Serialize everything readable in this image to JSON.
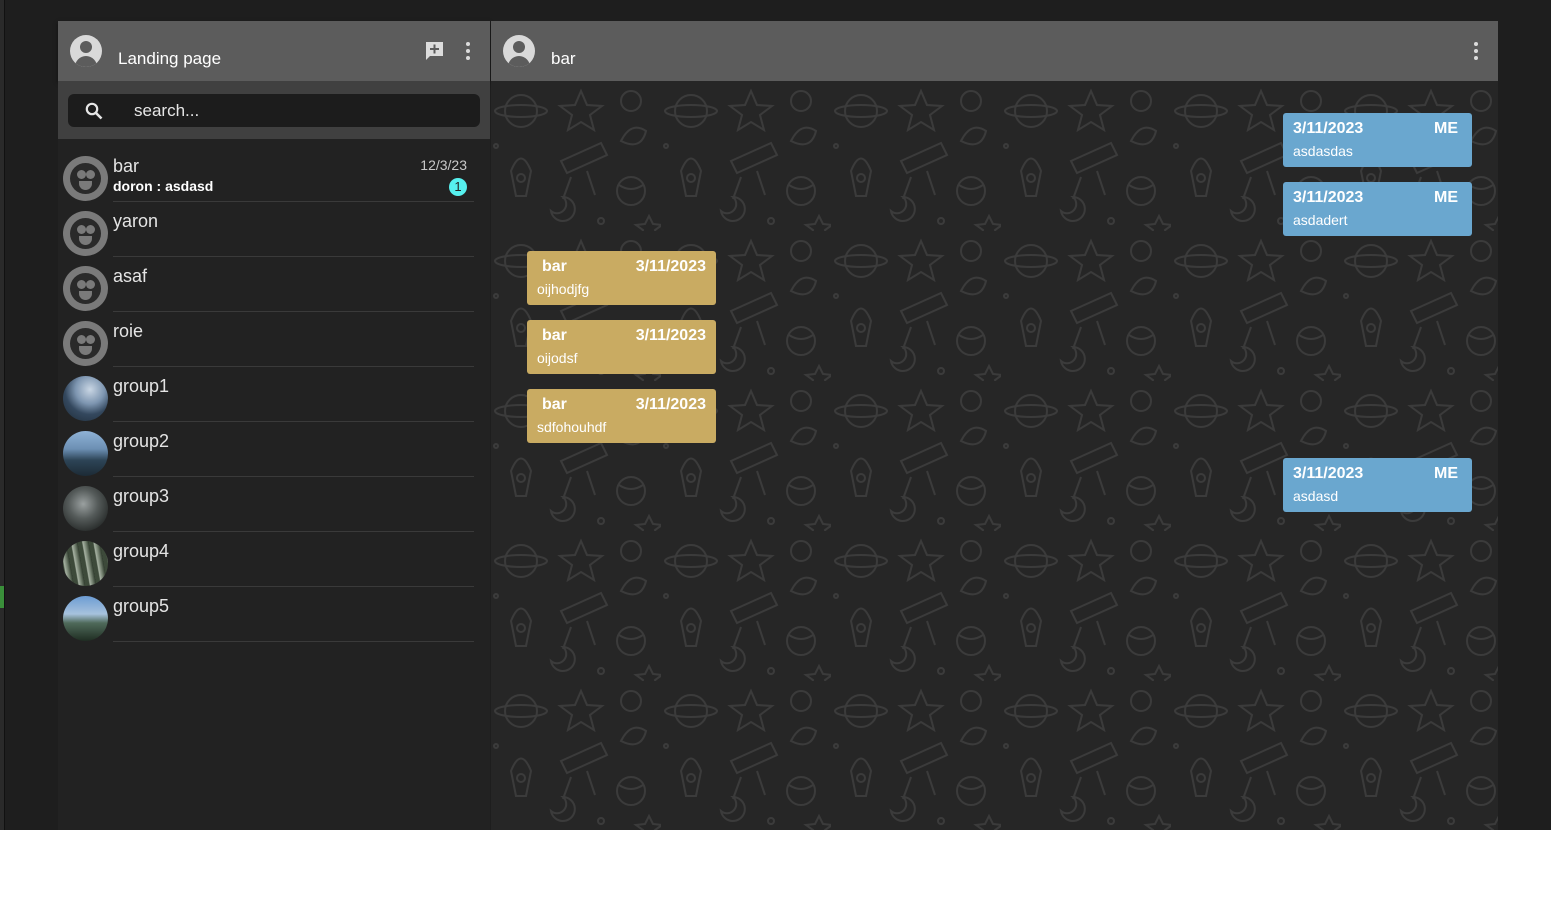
{
  "sidebar": {
    "title": "Landing page",
    "search_placeholder": "search...",
    "chats": [
      {
        "name": "bar",
        "preview": "doron : asdasd",
        "time": "12/3/23",
        "unread": "1",
        "avatar": "default"
      },
      {
        "name": "yaron",
        "avatar": "default"
      },
      {
        "name": "asaf",
        "avatar": "default"
      },
      {
        "name": "roie",
        "avatar": "default"
      },
      {
        "name": "group1",
        "avatar": "photo-mountain-lake"
      },
      {
        "name": "group2",
        "avatar": "photo-trees-sky"
      },
      {
        "name": "group3",
        "avatar": "photo-dark-interior"
      },
      {
        "name": "group4",
        "avatar": "photo-forest"
      },
      {
        "name": "group5",
        "avatar": "photo-valley-sky"
      }
    ]
  },
  "conversation": {
    "title": "bar",
    "messages": [
      {
        "from_me": true,
        "date": "3/11/2023",
        "sender": "ME",
        "text": "asdasdas"
      },
      {
        "from_me": true,
        "date": "3/11/2023",
        "sender": "ME",
        "text": "asdadert"
      },
      {
        "from_me": false,
        "date": "3/11/2023",
        "sender": "bar",
        "text": "oijhodjfg"
      },
      {
        "from_me": false,
        "date": "3/11/2023",
        "sender": "bar",
        "text": "oijodsf"
      },
      {
        "from_me": false,
        "date": "3/11/2023",
        "sender": "bar",
        "text": "sdfohouhdf"
      },
      {
        "from_me": true,
        "date": "3/11/2023",
        "sender": "ME",
        "text": "asdasd"
      }
    ]
  },
  "colors": {
    "header": "#5c5c5c",
    "my_bubble": "#6aa7cf",
    "their_bubble": "#c9ab62",
    "unread_badge": "#56f0ee"
  }
}
